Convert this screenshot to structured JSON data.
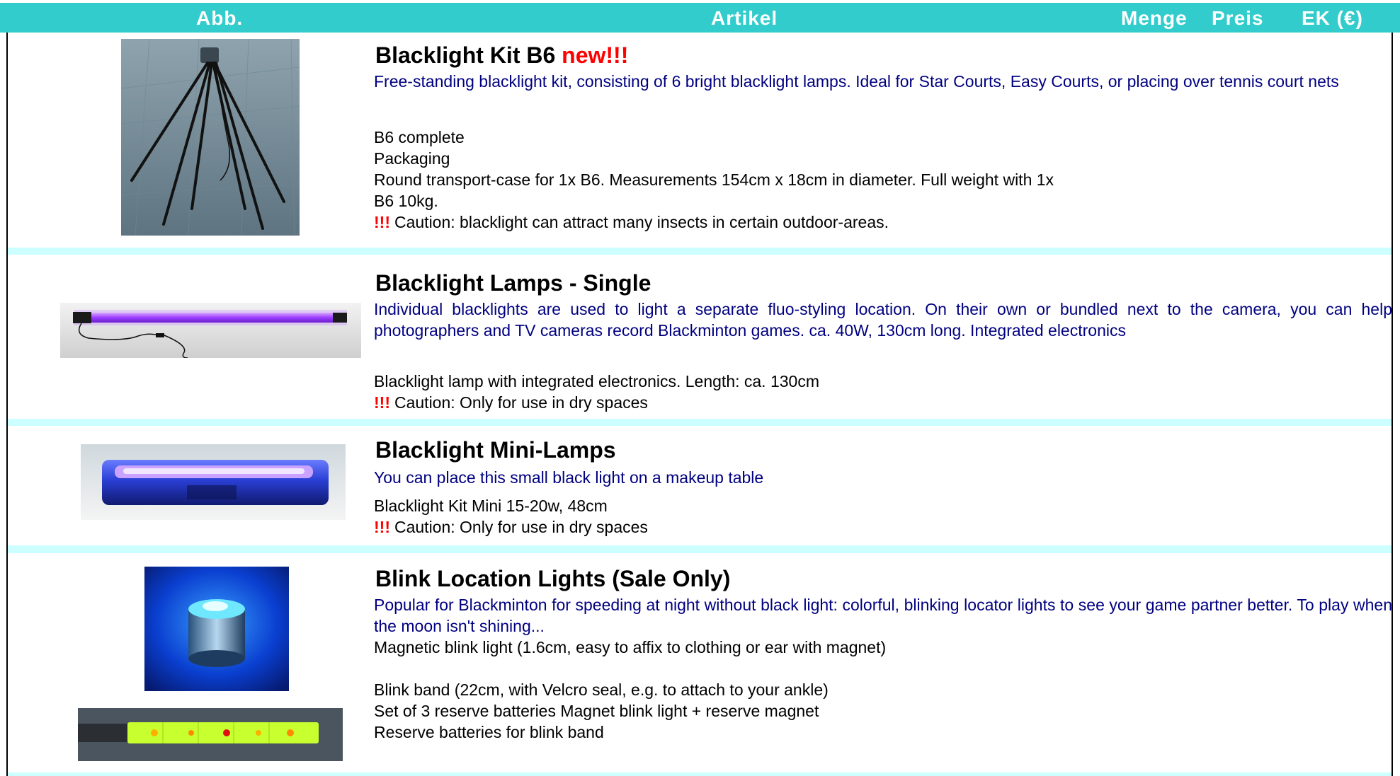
{
  "header": {
    "col_image": "Abb.",
    "col_article": "Artikel",
    "col_qty": "Menge",
    "col_price": "Preis",
    "col_ek": "EK (€)"
  },
  "products": [
    {
      "title": "Blacklight Kit B6",
      "badge": "new!!!",
      "description": "Free-standing blacklight kit, consisting of 6 bright blacklight lamps. Ideal for Star Courts, Easy Courts, or placing over tennis court nets",
      "lines": [
        "B6 complete",
        "Packaging",
        "Round transport-case for 1x B6. Measurements 154cm x 18cm in diameter. Full weight with 1x",
        "B6 10kg."
      ],
      "caution_mark": "!!!",
      "caution": "Caution: blacklight can attract many insects in certain outdoor-areas."
    },
    {
      "title": "Blacklight Lamps - Single",
      "description": "Individual blacklights are used to light a separate fluo-styling location. On their own or bundled next to the camera, you can help photographers and TV cameras record Blackminton games. ca. 40W, 130cm long. Integrated electronics",
      "lines": [
        "Blacklight lamp with integrated electronics. Length: ca. 130cm"
      ],
      "caution_mark": "!!!",
      "caution": "Caution: Only for use in dry spaces"
    },
    {
      "title": "Blacklight Mini-Lamps",
      "description": "You can place this small black light on a makeup table",
      "lines": [
        "Blacklight Kit Mini 15-20w, 48cm"
      ],
      "caution_mark": "!!!",
      "caution": "Caution: Only for use in dry spaces"
    },
    {
      "title": "Blink Location Lights (Sale Only)",
      "description": "Popular for Blackminton for speeding at night without black light: colorful, blinking locator lights to see your game partner better. To play when the moon isn't shining...",
      "lines": [
        "Magnetic blink light (1.6cm, easy to affix to clothing or ear with magnet)",
        "",
        "Blink band (22cm, with Velcro seal, e.g. to attach to your ankle)",
        "Set of 3 reserve batteries Magnet blink light + reserve magnet",
        "Reserve batteries for blink band"
      ]
    }
  ]
}
